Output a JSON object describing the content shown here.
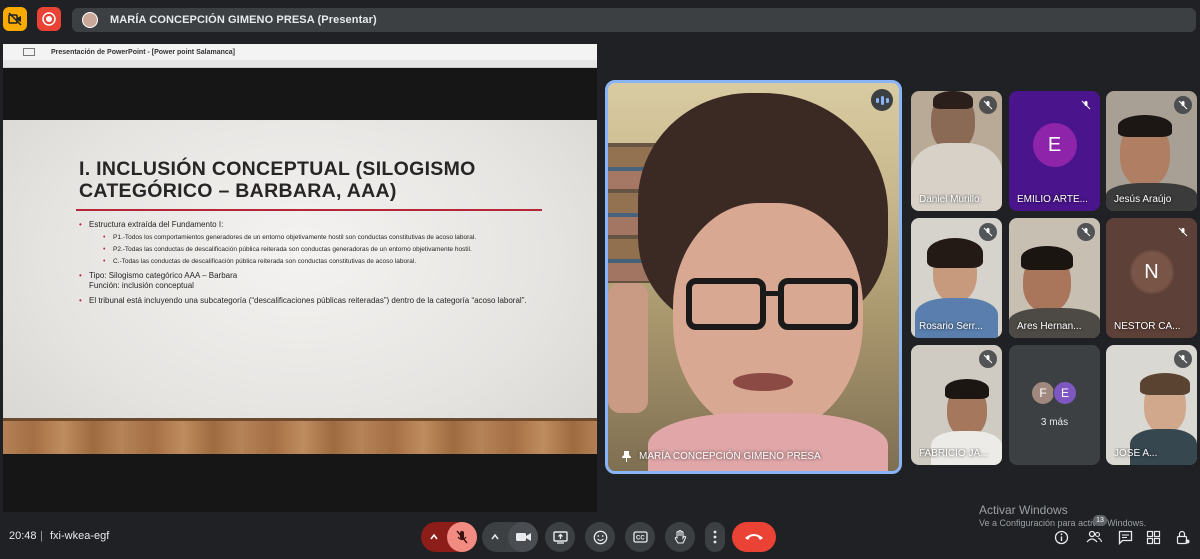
{
  "topbar": {
    "presenting_label": "MARÍA CONCEPCIÓN GIMENO PRESA (Presentar)"
  },
  "presentation": {
    "window_title": "Presentación de PowerPoint - [Power point Salamanca]",
    "slide": {
      "title_line1": "I. INCLUSIÓN CONCEPTUAL (SILOGISMO",
      "title_line2": "CATEGÓRICO – BARBARA, AAA)",
      "bullets": {
        "b1": "Estructura extraída del Fundamento I:",
        "b1_sub1": "P1.-Todos los comportamientos generadores de un entorno objetivamente hostil son conductas constitutivas de acoso laboral.",
        "b1_sub2": "P2.-Todas las conductas de descalificación pública reiterada son conductas generadoras de un entorno objetivamente hostil.",
        "b1_sub3": "C.-Todas las conductas de descalificación pública reiterada son conductas constitutivas de acoso laboral.",
        "b2_line1": "Tipo: Silogismo categórico AAA – Barbara",
        "b2_line2": "Función: inclusión conceptual",
        "b3": "El tribunal está incluyendo una subcategoría (“descalificaciones públicas reiteradas”) dentro de la categoría “acoso laboral”."
      }
    }
  },
  "main_speaker": {
    "name": "MARÍA CONCEPCIÓN GIMENO PRESA"
  },
  "participants": {
    "daniel": "Daniel Murillo",
    "emilio": "EMILIO ARTE...",
    "emilio_initial": "E",
    "jesus": "Jesús Araújo",
    "rosario": "Rosario Serr...",
    "ares": "Ares Hernan...",
    "nestor": "NESTOR CA...",
    "nestor_initial": "N",
    "fabricio": "FABRICIO JA...",
    "more_initial_1": "F",
    "more_initial_2": "E",
    "more_label": "3 más",
    "jose": "JOSÉ A..."
  },
  "watermark": {
    "title": "Activar Windows",
    "subtitle": "Ve a Configuración para activar Windows."
  },
  "bottombar": {
    "time": "20:48",
    "separator": "|",
    "meeting_code": "fxi-wkea-egf",
    "people_count": "13"
  },
  "colors": {
    "accent_blue": "#8ab4f8",
    "red": "#ea4335",
    "yellow": "#f9ab00",
    "slide_rule": "#b5263a",
    "emilio_avatar": "#8e24aa",
    "nestor_avatar": "#795548",
    "more_f": "#a1887f",
    "more_e": "#7e57c2"
  }
}
